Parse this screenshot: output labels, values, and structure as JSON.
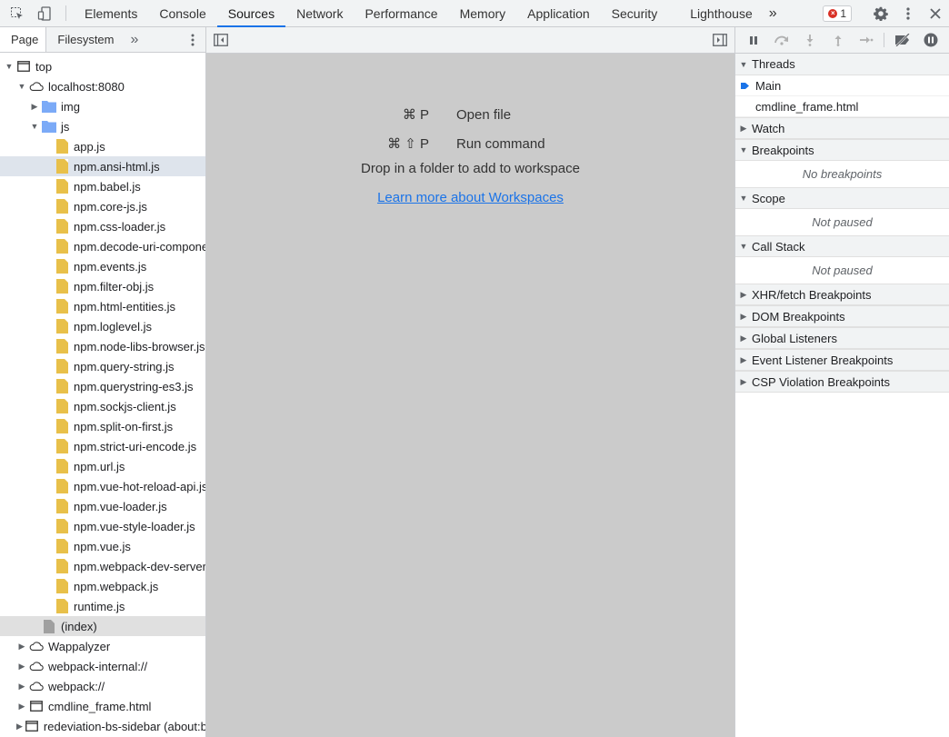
{
  "toolbar": {
    "tabs": [
      "Elements",
      "Console",
      "Sources",
      "Network",
      "Performance",
      "Memory",
      "Application",
      "Security",
      "Lighthouse"
    ],
    "active_tab": "Sources",
    "more": "»",
    "error_count": "1",
    "error_glyph": "×"
  },
  "navigator": {
    "tabs": [
      "Page",
      "Filesystem"
    ],
    "more": "»",
    "tree": {
      "top": "top",
      "host": "localhost:8080",
      "img": "img",
      "js": "js",
      "files": [
        "app.js",
        "npm.ansi-html.js",
        "npm.babel.js",
        "npm.core-js.js",
        "npm.css-loader.js",
        "npm.decode-uri-component.js",
        "npm.events.js",
        "npm.filter-obj.js",
        "npm.html-entities.js",
        "npm.loglevel.js",
        "npm.node-libs-browser.js",
        "npm.query-string.js",
        "npm.querystring-es3.js",
        "npm.sockjs-client.js",
        "npm.split-on-first.js",
        "npm.strict-uri-encode.js",
        "npm.url.js",
        "npm.vue-hot-reload-api.js",
        "npm.vue-loader.js",
        "npm.vue-style-loader.js",
        "npm.vue.js",
        "npm.webpack-dev-server.js",
        "npm.webpack.js",
        "runtime.js"
      ],
      "index": "(index)",
      "wappalyzer": "Wappalyzer",
      "webpack_internal": "webpack-internal://",
      "webpack": "webpack://",
      "cmdline": "cmdline_frame.html",
      "sidebar": "redeviation-bs-sidebar (about:blank)"
    }
  },
  "editor": {
    "shortcut1_key": "⌘ P",
    "shortcut1_label": "Open file",
    "shortcut2_key": "⌘ ⇧ P",
    "shortcut2_label": "Run command",
    "drop_text": "Drop in a folder to add to workspace",
    "learn_link": "Learn more about Workspaces"
  },
  "debugger": {
    "threads": "Threads",
    "thread_main": "Main",
    "thread_frame": "cmdline_frame.html",
    "watch": "Watch",
    "breakpoints": "Breakpoints",
    "no_breakpoints": "No breakpoints",
    "scope": "Scope",
    "not_paused_scope": "Not paused",
    "call_stack": "Call Stack",
    "not_paused_stack": "Not paused",
    "xhr": "XHR/fetch Breakpoints",
    "dom": "DOM Breakpoints",
    "global": "Global Listeners",
    "event": "Event Listener Breakpoints",
    "csp": "CSP Violation Breakpoints"
  }
}
